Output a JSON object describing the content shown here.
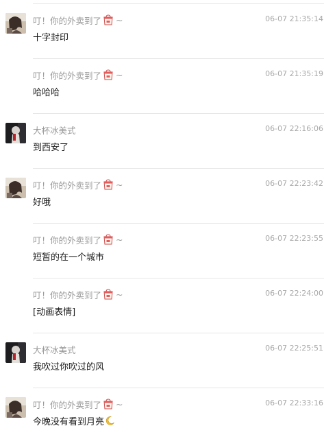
{
  "messages": [
    {
      "sender": "叮！你的外卖到了",
      "sender_suffix": "~",
      "has_takeout_emoji": true,
      "avatar": "girl",
      "show_avatar": true,
      "time": "06-07 21:35:14",
      "text": "十字封印"
    },
    {
      "sender": "叮！你的外卖到了",
      "sender_suffix": "~",
      "has_takeout_emoji": true,
      "avatar": "girl",
      "show_avatar": false,
      "time": "06-07 21:35:19",
      "text": "哈哈哈"
    },
    {
      "sender": "大杯冰美式",
      "sender_suffix": "",
      "has_takeout_emoji": false,
      "avatar": "dark",
      "show_avatar": true,
      "time": "06-07 22:16:06",
      "text": "到西安了"
    },
    {
      "sender": "叮！你的外卖到了",
      "sender_suffix": "~",
      "has_takeout_emoji": true,
      "avatar": "girl",
      "show_avatar": true,
      "time": "06-07 22:23:42",
      "text": "好哦"
    },
    {
      "sender": "叮！你的外卖到了",
      "sender_suffix": "~",
      "has_takeout_emoji": true,
      "avatar": "girl",
      "show_avatar": false,
      "time": "06-07 22:23:55",
      "text": "短暂的在一个城市"
    },
    {
      "sender": "叮！你的外卖到了",
      "sender_suffix": "~",
      "has_takeout_emoji": true,
      "avatar": "girl",
      "show_avatar": false,
      "time": "06-07 22:24:00",
      "text": "[动画表情]"
    },
    {
      "sender": "大杯冰美式",
      "sender_suffix": "",
      "has_takeout_emoji": false,
      "avatar": "dark",
      "show_avatar": true,
      "time": "06-07 22:25:51",
      "text": "我吹过你吹过的风"
    },
    {
      "sender": "叮！你的外卖到了",
      "sender_suffix": "~",
      "has_takeout_emoji": true,
      "avatar": "girl",
      "show_avatar": true,
      "time": "06-07 22:33:16",
      "text": "今晚没有看到月亮",
      "trailing_icon": "crescent-moon-icon"
    }
  ],
  "icons": {
    "takeout": "takeout-box-emoji-icon",
    "moon": "crescent-moon-icon"
  },
  "colors": {
    "sender_name": "#9a9a9a",
    "timestamp": "#a8a8a8",
    "message_text": "#1a1a1a",
    "divider": "#e6e6e6"
  }
}
